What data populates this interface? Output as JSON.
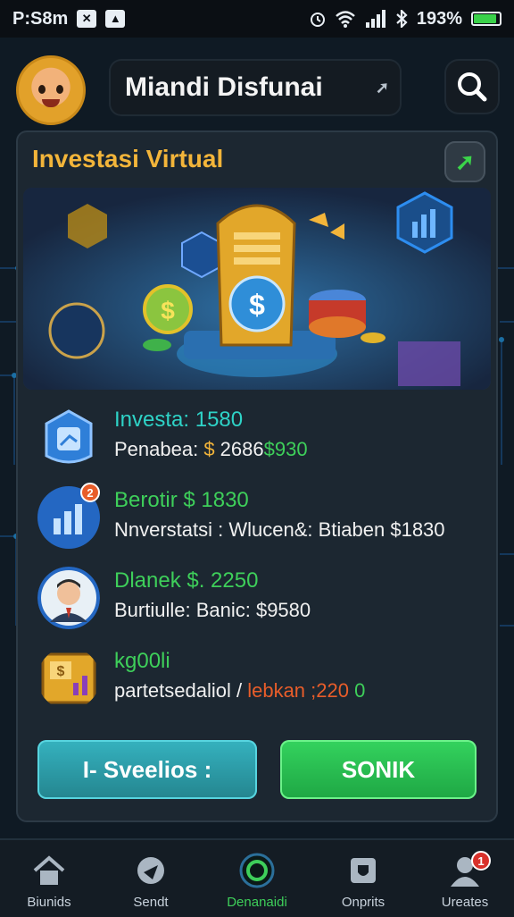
{
  "status_bar": {
    "time": "P:S8m",
    "right_text": "193%",
    "battery_level": 0.9
  },
  "header": {
    "title": "Miandi Disfunai",
    "search_icon": "search-icon"
  },
  "card": {
    "title": "Investasi Virtual",
    "rows": [
      {
        "top": "Investa: 1580",
        "bottom_label": "Penabea: ",
        "bottom_dollar": "$",
        "bottom_value": " 2686",
        "bottom_green": "$930",
        "top_color": "#2ed3c7"
      },
      {
        "top": "Berotir $ 1830",
        "bottom_label": "Nnverstatsi : Wlucen&: Btiaben $1830",
        "badge": "2",
        "top_color": "#3ecf5a"
      },
      {
        "top": "Dlanek $. 2250",
        "bottom_label": "Burtiulle: Banic: $9580",
        "top_color": "#3ecf5a"
      },
      {
        "top": "kg00li",
        "bottom_label": "partetsedaliol /",
        "bottom_red": " lebkan ;220",
        "bottom_green": " 0",
        "top_color": "#3ecf5a"
      }
    ],
    "buttons": {
      "left": "I- Sveelios :",
      "right": "SONIK"
    }
  },
  "nav": {
    "items": [
      {
        "label": "Biunids",
        "icon": "home-icon"
      },
      {
        "label": "Sendt",
        "icon": "send-icon"
      },
      {
        "label": "Denanaidi",
        "icon": "center-circle-icon"
      },
      {
        "label": "Onprits",
        "icon": "shield-icon"
      },
      {
        "label": "Ureates",
        "icon": "profile-icon",
        "badge": "1"
      }
    ]
  }
}
